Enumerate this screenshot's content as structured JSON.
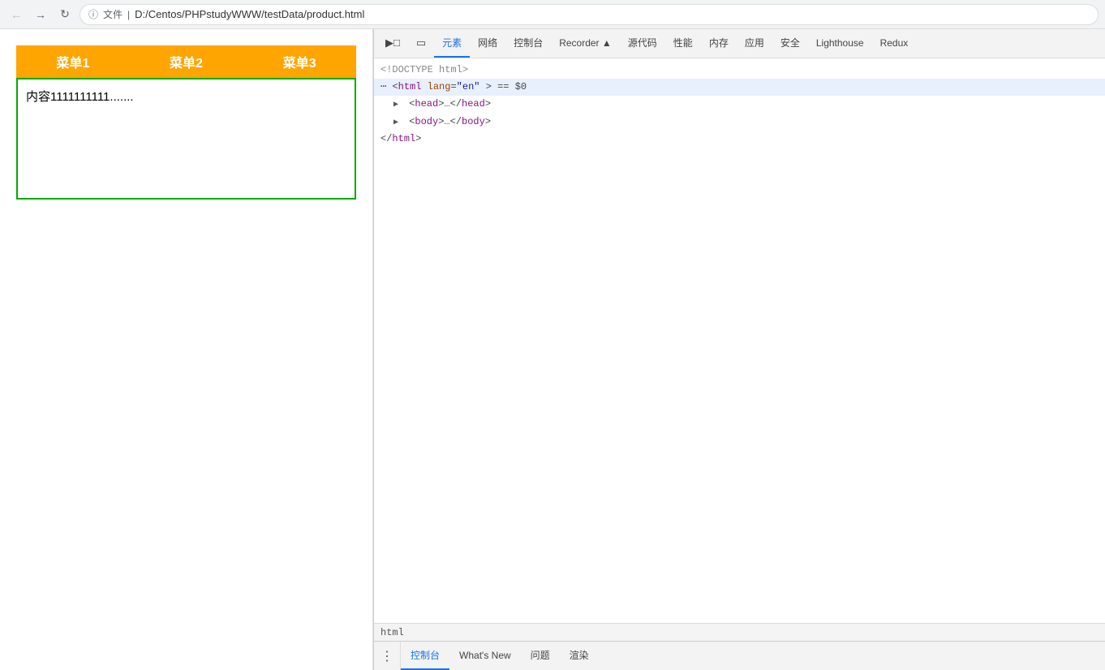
{
  "browser": {
    "url": "D:/Centos/PHPstudyWWW/testData/product.html",
    "file_label": "文件",
    "separator": "|"
  },
  "page": {
    "menu": {
      "items": [
        "菜单1",
        "菜单2",
        "菜单3"
      ]
    },
    "content": "内容1111111111......."
  },
  "devtools": {
    "tabs": [
      {
        "label": "元素",
        "active": true
      },
      {
        "label": "网络",
        "active": false
      },
      {
        "label": "控制台",
        "active": false
      },
      {
        "label": "Recorder ▲",
        "active": false
      },
      {
        "label": "源代码",
        "active": false
      },
      {
        "label": "性能",
        "active": false
      },
      {
        "label": "内存",
        "active": false
      },
      {
        "label": "应用",
        "active": false
      },
      {
        "label": "安全",
        "active": false
      },
      {
        "label": "Lighthouse",
        "active": false
      },
      {
        "label": "Redux",
        "active": false
      }
    ],
    "tab_icons": [
      {
        "label": "📱",
        "title": "inspect"
      },
      {
        "label": "⊡",
        "title": "device"
      }
    ],
    "html_tree": {
      "doctype": "<!DOCTYPE html>",
      "html_tag": "<html lang=\"en\">  == $0",
      "head": "▶ <head>…</head>",
      "body": "▶ <body>…</body>",
      "closing": "</html>"
    },
    "breadcrumb": "html",
    "footer_tabs": [
      {
        "label": "控制台",
        "active": true
      },
      {
        "label": "What's New",
        "active": false
      },
      {
        "label": "问题",
        "active": false
      },
      {
        "label": "渲染",
        "active": false
      }
    ],
    "footer_dots": "⋮"
  }
}
